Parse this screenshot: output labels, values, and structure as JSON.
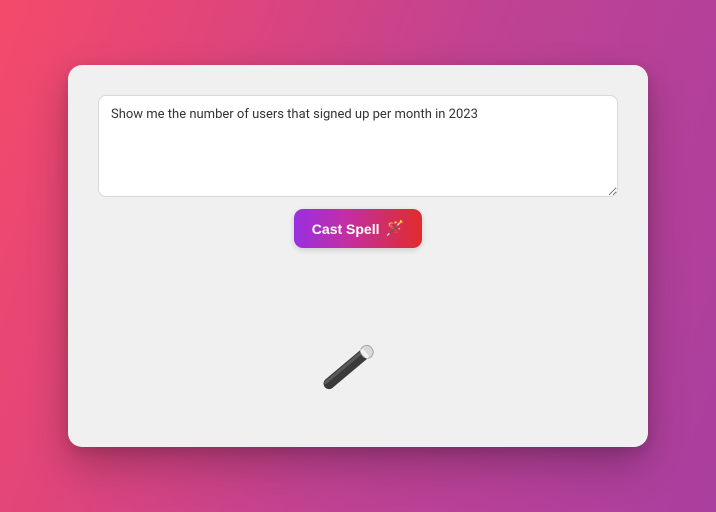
{
  "query": {
    "value": "Show me the number of users that signed up per month in 2023",
    "placeholder": ""
  },
  "button": {
    "label": "Cast Spell",
    "icon": "🪄"
  }
}
